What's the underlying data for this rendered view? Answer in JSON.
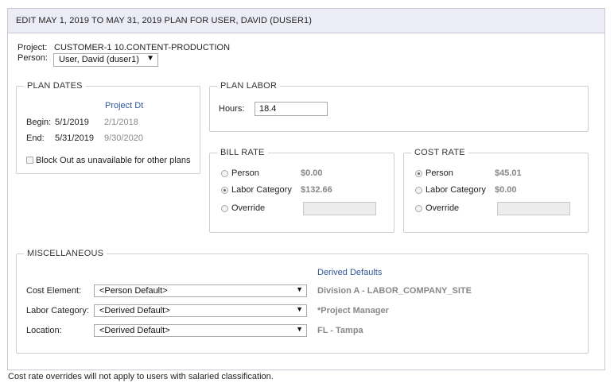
{
  "header": {
    "title": "EDIT MAY 1, 2019 TO MAY 31, 2019 PLAN FOR USER, DAVID (DUSER1)"
  },
  "project": {
    "label": "Project:",
    "value": "CUSTOMER-1 10.CONTENT-PRODUCTION"
  },
  "person": {
    "label": "Person:",
    "selected": "User, David (duser1)"
  },
  "plan_dates": {
    "legend": "PLAN DATES",
    "project_dt_header": "Project Dt",
    "begin_label": "Begin:",
    "begin_value": "5/1/2019",
    "begin_project": "2/1/2018",
    "end_label": "End:",
    "end_value": "5/31/2019",
    "end_project": "9/30/2020",
    "block_out_label": "Block Out as unavailable for other plans"
  },
  "plan_labor": {
    "legend": "PLAN LABOR",
    "hours_label": "Hours:",
    "hours_value": "18.4"
  },
  "bill_rate": {
    "legend": "BILL RATE",
    "options": [
      {
        "label": "Person",
        "value": "$0.00"
      },
      {
        "label": "Labor Category",
        "value": "$132.66"
      },
      {
        "label": "Override",
        "value": ""
      }
    ]
  },
  "cost_rate": {
    "legend": "COST RATE",
    "options": [
      {
        "label": "Person",
        "value": "$45.01"
      },
      {
        "label": "Labor Category",
        "value": "$0.00"
      },
      {
        "label": "Override",
        "value": ""
      }
    ]
  },
  "misc": {
    "legend": "MISCELLANEOUS",
    "derived_header": "Derived Defaults",
    "rows": [
      {
        "label": "Cost Element:",
        "selected": "<Person Default>",
        "derived": "Division A - LABOR_COMPANY_SITE"
      },
      {
        "label": "Labor Category:",
        "selected": "<Derived Default>",
        "derived": "*Project Manager"
      },
      {
        "label": "Location:",
        "selected": "<Derived Default>",
        "derived": "FL - Tampa"
      }
    ]
  },
  "footer_note": "Cost rate overrides will not apply to users with salaried classification.",
  "icons": {
    "dropdown": "chevron-down-icon"
  }
}
